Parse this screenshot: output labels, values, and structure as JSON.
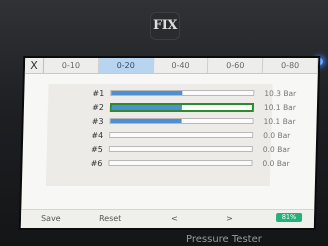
{
  "device": {
    "logo_text": "FIX",
    "label": "Pressure Tester"
  },
  "tabs": {
    "close_label": "X",
    "items": [
      "0-10",
      "0-20",
      "0-40",
      "0-60",
      "0-80"
    ],
    "active_index": 1
  },
  "channels": [
    {
      "label": "#1",
      "value": "10.3 Bar",
      "fill_fraction": 0.5,
      "selected": false
    },
    {
      "label": "#2",
      "value": "10.1 Bar",
      "fill_fraction": 0.5,
      "selected": true
    },
    {
      "label": "#3",
      "value": "10.1 Bar",
      "fill_fraction": 0.5,
      "selected": false
    },
    {
      "label": "#4",
      "value": "0.0 Bar",
      "fill_fraction": 0,
      "selected": false
    },
    {
      "label": "#5",
      "value": "0.0 Bar",
      "fill_fraction": 0,
      "selected": false
    },
    {
      "label": "#6",
      "value": "0.0 Bar",
      "fill_fraction": 0,
      "selected": false
    }
  ],
  "bottom_bar": {
    "save_label": "Save",
    "reset_label": "Reset",
    "prev_label": "<",
    "next_label": ">",
    "battery_text": "81%"
  },
  "colors": {
    "fill": "#4d8fd0",
    "selected_border": "#2f8a2f",
    "active_tab": "#b8d4ee",
    "battery": "#27b07a",
    "status_led": "#6aa6ff"
  }
}
